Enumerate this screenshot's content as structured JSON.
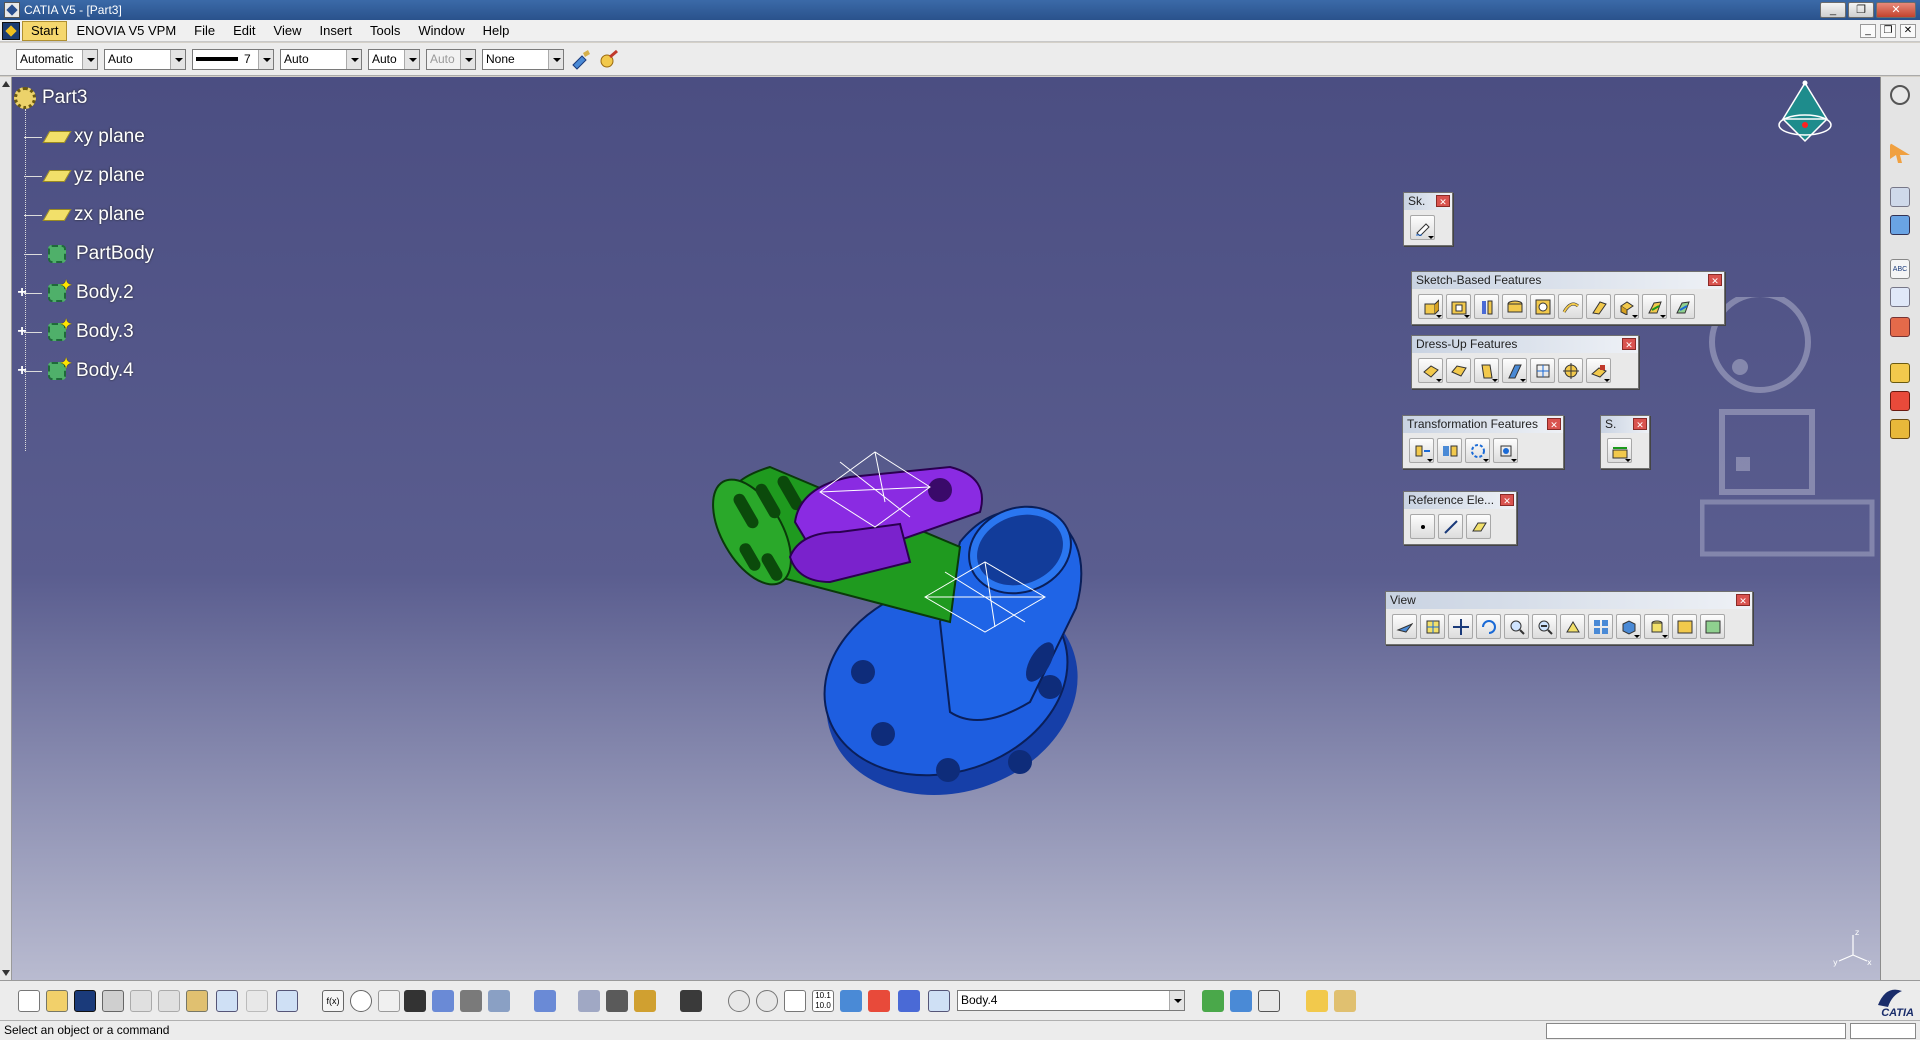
{
  "window": {
    "title": "CATIA V5 - [Part3]"
  },
  "menu": {
    "start": "Start",
    "enovia": "ENOVIA V5 VPM",
    "items": [
      "File",
      "Edit",
      "View",
      "Insert",
      "Tools",
      "Window",
      "Help"
    ]
  },
  "props": {
    "color": "Automatic",
    "transparency": "Auto",
    "linewidth": "7",
    "linetype": "Auto",
    "point": "Auto",
    "layer_disabled": "Auto",
    "layer": "None"
  },
  "tree": {
    "root": "Part3",
    "items": [
      {
        "label": "xy plane",
        "kind": "plane"
      },
      {
        "label": "yz plane",
        "kind": "plane"
      },
      {
        "label": "zx plane",
        "kind": "plane"
      },
      {
        "label": "PartBody",
        "kind": "body"
      },
      {
        "label": "Body.2",
        "kind": "body-expandable"
      },
      {
        "label": "Body.3",
        "kind": "body-expandable"
      },
      {
        "label": "Body.4",
        "kind": "body-expandable"
      }
    ]
  },
  "toolbars": {
    "sketcher": "Sk.",
    "sketch_based": "Sketch-Based Features",
    "dress_up": "Dress-Up Features",
    "transformation": "Transformation Features",
    "s_short": "S.",
    "reference": "Reference Ele...",
    "view": "View"
  },
  "bottom": {
    "body_select": "Body.4",
    "brand": "CATIA"
  },
  "status": {
    "message": "Select an object or a command"
  },
  "colors": {
    "viewport_top": "#4b4e82",
    "viewport_bottom": "#b9bbd0",
    "green_part": "#1f9a1f",
    "purple_part": "#8a2be2",
    "blue_part": "#1e5ee0"
  }
}
